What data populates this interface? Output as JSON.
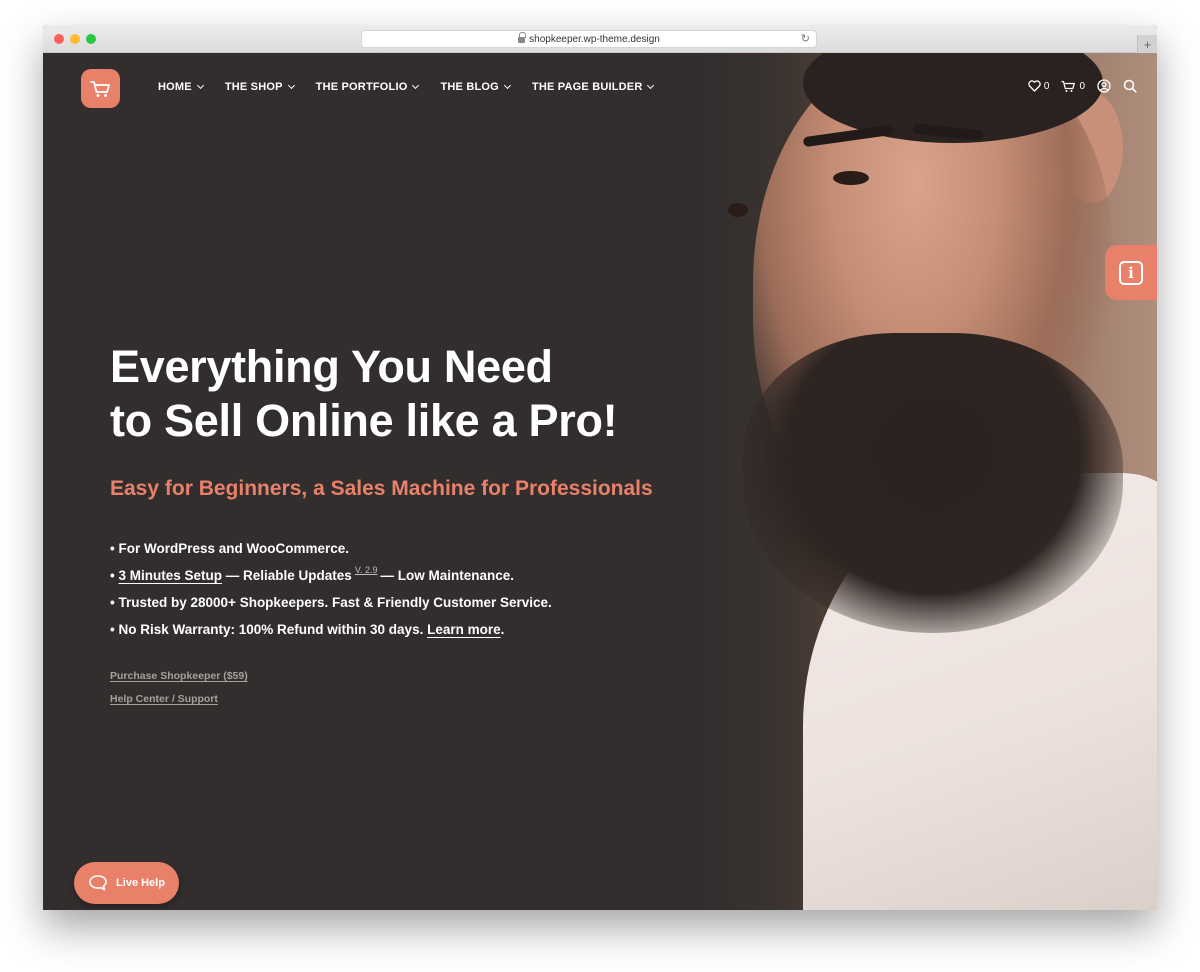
{
  "browser": {
    "url": "shopkeeper.wp-theme.design",
    "new_tab_label": "+"
  },
  "nav": {
    "menu": [
      {
        "label": "HOME"
      },
      {
        "label": "THE SHOP"
      },
      {
        "label": "THE PORTFOLIO"
      },
      {
        "label": "THE BLOG"
      },
      {
        "label": "THE PAGE BUILDER"
      }
    ],
    "wishlist_count": "0",
    "cart_count": "0"
  },
  "hero": {
    "headline_line1": "Everything You Need",
    "headline_line2": "to Sell Online like a Pro!",
    "subheadline": "Easy for Beginners, a Sales Machine for Professionals",
    "bullet_prefix": "•",
    "bullet1": "For WordPress and WooCommerce.",
    "bullet2_link": "3 Minutes Setup",
    "bullet2_mid": "— Reliable Updates",
    "bullet2_version": "V. 2.9",
    "bullet2_end": "— Low Maintenance.",
    "bullet3": "Trusted by 28000+ Shopkeepers. Fast & Friendly Customer Service.",
    "bullet4_text": "No Risk Warranty: 100% Refund within 30 days.",
    "bullet4_link": "Learn more",
    "bullet4_end": ".",
    "purchase_link": "Purchase Shopkeeper ($59)",
    "support_link": "Help Center / Support"
  },
  "info_tab": {
    "glyph": "i"
  },
  "live_help": {
    "label": "Live Help"
  },
  "colors": {
    "accent": "#e8806a",
    "background": "#322e2d",
    "text": "#ffffff"
  }
}
